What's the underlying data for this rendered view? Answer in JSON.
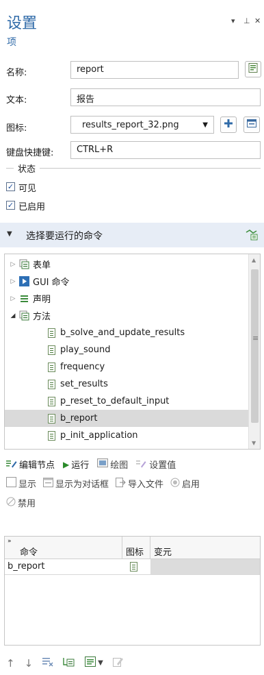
{
  "panel": {
    "title": "设置",
    "subtitle": "项",
    "controls": {
      "dropdown": "▾",
      "pin": "⊥",
      "close": "✕"
    }
  },
  "form": {
    "name_label": "名称:",
    "name_value": "report",
    "text_label": "文本:",
    "text_value": "报告",
    "icon_label": "图标:",
    "icon_value": "results_report_32.png",
    "shortcut_label": "键盘快捷键:",
    "shortcut_value": "CTRL+R"
  },
  "state": {
    "group_title": "状态",
    "visible_label": "可见",
    "visible_checked": true,
    "enabled_label": "已启用",
    "enabled_checked": true
  },
  "commands_section": {
    "title": "选择要运行的命令"
  },
  "tree": {
    "items": [
      {
        "label": "表单",
        "level": 0,
        "expanded": false,
        "icon": "form-icon"
      },
      {
        "label": "GUI 命令",
        "level": 0,
        "expanded": false,
        "icon": "gui-command-icon"
      },
      {
        "label": "声明",
        "level": 0,
        "expanded": false,
        "icon": "declarations-icon"
      },
      {
        "label": "方法",
        "level": 0,
        "expanded": true,
        "icon": "methods-icon"
      },
      {
        "label": "b_solve_and_update_results",
        "level": 1,
        "icon": "method-icon"
      },
      {
        "label": "play_sound",
        "level": 1,
        "icon": "method-icon"
      },
      {
        "label": "frequency",
        "level": 1,
        "icon": "method-icon"
      },
      {
        "label": "set_results",
        "level": 1,
        "icon": "method-icon"
      },
      {
        "label": "p_reset_to_default_input",
        "level": 1,
        "icon": "method-icon"
      },
      {
        "label": "b_report",
        "level": 1,
        "icon": "method-icon",
        "selected": true
      },
      {
        "label": "p_init_application",
        "level": 1,
        "icon": "method-icon"
      }
    ]
  },
  "toolbar1": {
    "edit_node": "编辑节点",
    "run": "运行",
    "plot": "绘图",
    "set_value": "设置值"
  },
  "toolbar2": {
    "show": "显示",
    "show_as_dialog": "显示为对话框",
    "import_file": "导入文件",
    "enable": "启用",
    "disable": "禁用"
  },
  "commands_table": {
    "columns": [
      "命令",
      "图标",
      "变元"
    ],
    "rows": [
      {
        "command": "b_report",
        "icon": "method-icon",
        "argument": ""
      }
    ]
  },
  "colors": {
    "accent": "#2f6aa8",
    "section_bg": "#e7edf6",
    "selection": "#dadada"
  }
}
